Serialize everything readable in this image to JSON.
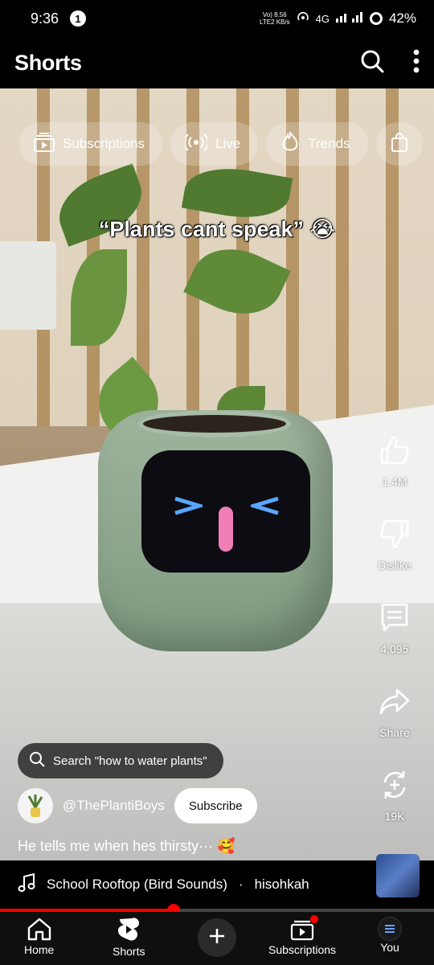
{
  "status_bar": {
    "time": "9:36",
    "notification_count": "1",
    "network_line1": "Vo) 8.56",
    "network_line2": "LTE2 KB/s",
    "network_type": "4G",
    "battery": "42%"
  },
  "header": {
    "title": "Shorts"
  },
  "chips": [
    {
      "label": "Subscriptions",
      "icon": "subscriptions-icon"
    },
    {
      "label": "Live",
      "icon": "live-icon"
    },
    {
      "label": "Trends",
      "icon": "trends-icon"
    }
  ],
  "video": {
    "caption": "“Plants cant speak” 😭"
  },
  "actions": {
    "like_count": "1.4M",
    "dislike_label": "Dislike",
    "comment_count": "4,095",
    "share_label": "Share",
    "remix_count": "19K"
  },
  "search_suggestion": "Search \"how to water plants\"",
  "channel": {
    "name": "@ThePlantiBoys",
    "subscribe_label": "Subscribe"
  },
  "description": "He tells me when hes thirsty··· 🥰",
  "music": {
    "title": "School Rooftop (Bird Sounds)",
    "separator": "·",
    "artist": "hisohkah"
  },
  "progress": {
    "fraction": 0.4
  },
  "bottom_nav": {
    "home": "Home",
    "shorts": "Shorts",
    "subscriptions": "Subscriptions",
    "you": "You"
  },
  "colors": {
    "accent_red": "#ff0000",
    "robot_green": "#8fa78e",
    "eye_blue": "#5aa6ff",
    "mouth_pink": "#f07fb8"
  }
}
